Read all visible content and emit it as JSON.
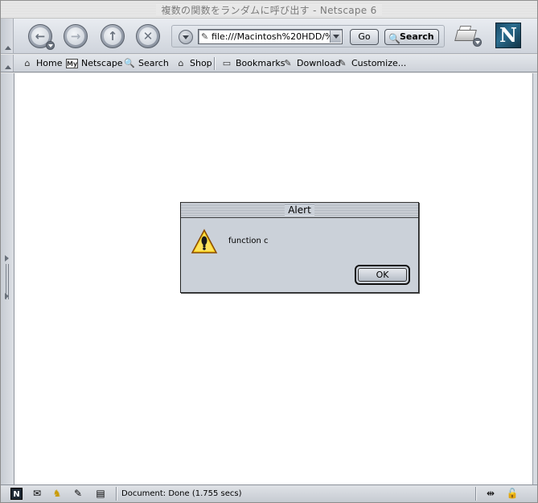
{
  "window": {
    "title": "複数の関数をランダムに呼び出す - Netscape 6"
  },
  "navbar": {
    "back_icon": "back-arrow-icon",
    "forward_icon": "forward-arrow-icon",
    "reload_icon": "reload-icon",
    "stop_icon": "stop-icon",
    "url_value": "file:///Macintosh%20HDD/%9",
    "go_label": "Go",
    "search_label": "Search"
  },
  "personalbar": {
    "items": [
      {
        "label": "Home",
        "icon": "home-icon"
      },
      {
        "label": "Netscape",
        "icon": "my-netscape-icon",
        "badge": "My"
      },
      {
        "label": "Search",
        "icon": "search-icon"
      },
      {
        "label": "Shop",
        "icon": "shop-icon"
      },
      {
        "label": "Bookmarks",
        "icon": "bookmarks-folder-icon"
      },
      {
        "label": "Download",
        "icon": "bookmark-icon"
      },
      {
        "label": "Customize...",
        "icon": "bookmark-icon"
      }
    ]
  },
  "alert": {
    "title": "Alert",
    "message": "function c",
    "ok_label": "OK"
  },
  "statusbar": {
    "status_text": "Document: Done (1.755 secs)",
    "icons": [
      "netscape-icon",
      "mail-icon",
      "instant-messenger-icon",
      "composer-icon",
      "address-book-icon",
      "online-status-icon",
      "security-lock-icon"
    ]
  },
  "colors": {
    "accent": "#2b6d8f",
    "chrome": "#cfd4dc",
    "dialog": "#cbd1d9"
  }
}
